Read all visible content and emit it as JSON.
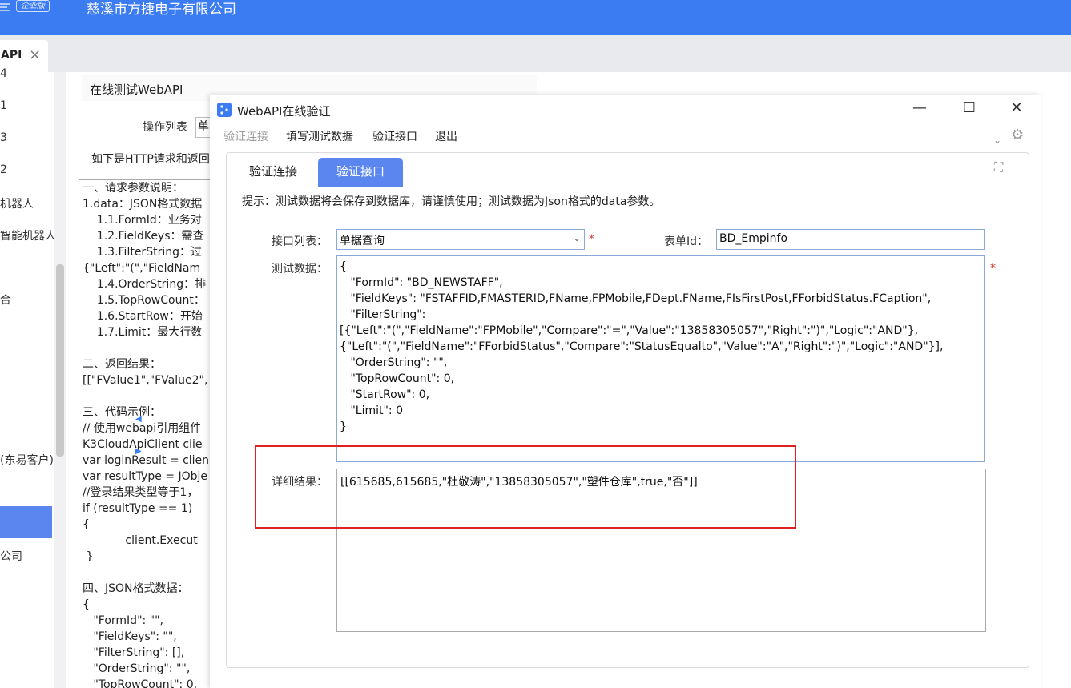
{
  "header": {
    "badge": "企业版",
    "company": "慈溪市方捷电子有限公司"
  },
  "tab": {
    "label": "API",
    "close": "×"
  },
  "nav": {
    "items": [
      "4",
      "1",
      "3",
      "2",
      "机器人",
      "智能机器人",
      "合",
      "(东易客户)",
      "公司"
    ]
  },
  "bg": {
    "title": "在线测试WebAPI",
    "op_label": "操作列表",
    "op_value": "单",
    "http_text": "如下是HTTP请求和返回",
    "doc_lines": [
      "一、请求参数说明：",
      "1.data：JSON格式数据",
      "    1.1.FormId：业务对",
      "    1.2.FieldKeys：需查",
      "    1.3.FilterString：过",
      "{\"Left\":\"(\",\"FieldNam",
      "    1.4.OrderString：排",
      "    1.5.TopRowCount：",
      "    1.6.StartRow：开始",
      "    1.7.Limit：最大行数",
      "",
      "二、返回结果：",
      "[[\"FValue1\",\"FValue2\",",
      "",
      "三、代码示例：",
      "// 使用webapi引用组件",
      "K3CloudApiClient clie",
      "var loginResult = clien",
      "var resultType = JObje",
      "//登录结果类型等于1，",
      "if (resultType == 1)",
      "{",
      "            client.Execut",
      " }",
      "",
      "四、JSON格式数据：",
      "{",
      "   \"FormId\": \"\",",
      "   \"FieldKeys\": \"\",",
      "   \"FilterString\": [],",
      "   \"OrderString\": \"\",",
      "   \"TopRowCount\": 0,"
    ]
  },
  "dialog": {
    "title": "WebAPI在线验证",
    "win_min": "—",
    "win_max": "☐",
    "win_close": "✕",
    "menu": {
      "verify_conn": "验证连接",
      "fill_test": "填写测试数据",
      "verify_api": "验证接口",
      "exit": "退出"
    },
    "tabs": [
      "验证连接",
      "验证接口"
    ],
    "tip": "提示：测试数据将会保存到数据库，请谨慎使用；测试数据为Json格式的data参数。",
    "api_list_label": "接口列表：",
    "api_list_value": "单据查询",
    "form_id_label": "表单Id：",
    "form_id_value": "BD_Empinfo",
    "test_data_label": "测试数据：",
    "test_data_lines": [
      "{",
      "   \"FormId\": \"BD_NEWSTAFF\",",
      "   \"FieldKeys\": \"FSTAFFID,FMASTERID,FName,FPMobile,FDept.FName,FIsFirstPost,FForbidStatus.FCaption\",",
      "   \"FilterString\":",
      "[{\"Left\":\"(\",\"FieldName\":\"FPMobile\",\"Compare\":\"=\",\"Value\":\"13858305057\",\"Right\":\")\",\"Logic\":\"AND\"},",
      "{\"Left\":\"(\",\"FieldName\":\"FForbidStatus\",\"Compare\":\"StatusEqualto\",\"Value\":\"A\",\"Right\":\")\",\"Logic\":\"AND\"}],",
      "   \"OrderString\": \"\",",
      "   \"TopRowCount\": 0,",
      "   \"StartRow\": 0,",
      "   \"Limit\": 0",
      "}"
    ],
    "result_label": "详细结果：",
    "result_value": "[[615685,615685,\"杜敬涛\",\"13858305057\",\"塑件仓库\",true,\"否\"]]",
    "required_mark": "*"
  },
  "colors": {
    "brand": "#3b7cf3",
    "tab_active": "#5b86f0",
    "highlight": "#e02020"
  }
}
